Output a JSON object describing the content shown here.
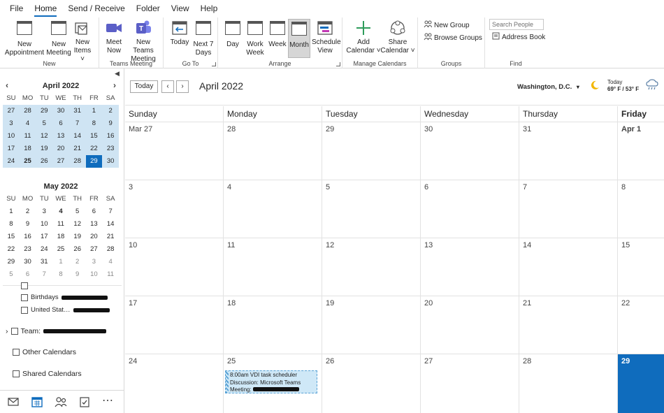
{
  "menu": {
    "tabs": [
      "File",
      "Home",
      "Send / Receive",
      "Folder",
      "View",
      "Help"
    ],
    "active_tab": "Home"
  },
  "ribbon": {
    "new_group": {
      "label": "New",
      "new_appointment": "New Appointment",
      "new_meeting": "New Meeting",
      "new_items": "New Items ˅"
    },
    "teams_group": {
      "label": "Teams Meeting",
      "meet_now": "Meet Now",
      "new_teams_meeting": "New Teams Meeting"
    },
    "goto_group": {
      "label": "Go To",
      "today": "Today",
      "next7": "Next 7 Days"
    },
    "arrange_group": {
      "label": "Arrange",
      "day": "Day",
      "work_week": "Work Week",
      "week": "Week",
      "month": "Month",
      "schedule_view": "Schedule View"
    },
    "manage_group": {
      "label": "Manage Calendars",
      "add_calendar": "Add Calendar ˅",
      "share_calendar": "Share Calendar ˅"
    },
    "groups_group": {
      "label": "Groups",
      "new_group": "New Group",
      "browse_groups": "Browse Groups"
    },
    "find_group": {
      "label": "Find",
      "search_placeholder": "Search People",
      "address_book": "Address Book"
    }
  },
  "left_pane": {
    "april": {
      "title": "April 2022",
      "dow": [
        "SU",
        "MO",
        "TU",
        "WE",
        "TH",
        "FR",
        "SA"
      ],
      "days": [
        "27",
        "28",
        "29",
        "30",
        "31",
        "1",
        "2",
        "3",
        "4",
        "5",
        "6",
        "7",
        "8",
        "9",
        "10",
        "11",
        "12",
        "13",
        "14",
        "15",
        "16",
        "17",
        "18",
        "19",
        "20",
        "21",
        "22",
        "23",
        "24",
        "25",
        "26",
        "27",
        "28",
        "29",
        "30"
      ]
    },
    "may": {
      "title": "May 2022",
      "dow": [
        "SU",
        "MO",
        "TU",
        "WE",
        "TH",
        "FR",
        "SA"
      ],
      "days": [
        "1",
        "2",
        "3",
        "4",
        "5",
        "6",
        "7",
        "8",
        "9",
        "10",
        "11",
        "12",
        "13",
        "14",
        "15",
        "16",
        "17",
        "18",
        "19",
        "20",
        "21",
        "22",
        "23",
        "24",
        "25",
        "26",
        "27",
        "28",
        "29",
        "30",
        "31",
        "1",
        "2",
        "3",
        "4",
        "5",
        "6",
        "7",
        "8",
        "9",
        "10",
        "11"
      ]
    },
    "folders": {
      "birthdays": "Birthdays",
      "holidays": "United Stat…",
      "team": "Team:",
      "other_calendars": "Other Calendars",
      "shared_calendars": "Shared Calendars"
    }
  },
  "bottom_nav": [
    "mail-icon",
    "calendar-icon",
    "people-icon",
    "tasks-icon",
    "more-icon"
  ],
  "calendar": {
    "today_button": "Today",
    "title": "April 2022",
    "weather": {
      "location": "Washington, D.C.",
      "today_label": "Today",
      "temps": "69° F / 53° F"
    },
    "weekdays": [
      "Sunday",
      "Monday",
      "Tuesday",
      "Wednesday",
      "Thursday",
      "Friday"
    ],
    "weeks": [
      [
        "Mar 27",
        "28",
        "29",
        "30",
        "31",
        "Apr 1"
      ],
      [
        "3",
        "4",
        "5",
        "6",
        "7",
        "8"
      ],
      [
        "10",
        "11",
        "12",
        "13",
        "14",
        "15"
      ],
      [
        "17",
        "18",
        "19",
        "20",
        "21",
        "22"
      ],
      [
        "24",
        "25",
        "26",
        "27",
        "28",
        "29"
      ]
    ],
    "event": {
      "line1": "8:00am VDI task scheduler",
      "line2": "Discussion: Microsoft Teams",
      "line3": "Meeting:"
    },
    "colors": {
      "accent": "#0f6cbd",
      "shade": "#cfe4f3",
      "event_bg": "#cfe8f7"
    }
  }
}
